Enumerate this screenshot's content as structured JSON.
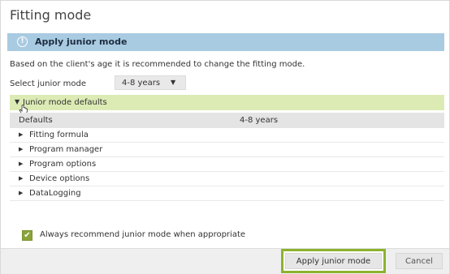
{
  "window": {
    "title": "Fitting mode"
  },
  "banner": {
    "icon": "info-icon",
    "text": "Apply junior mode"
  },
  "description": "Based on the client's age it is recommended to change the fitting mode.",
  "junior_mode": {
    "label": "Select junior mode",
    "selected": "4-8 years"
  },
  "section": {
    "title": "Junior mode defaults",
    "expanded": true
  },
  "table": {
    "columns": [
      "Defaults",
      "4-8 years"
    ],
    "rows": [
      "Fitting formula",
      "Program manager",
      "Program options",
      "Device options",
      "DataLogging"
    ]
  },
  "checkbox": {
    "label": "Always recommend junior mode when appropriate",
    "checked": true
  },
  "buttons": {
    "apply": "Apply junior mode",
    "cancel": "Cancel"
  },
  "colors": {
    "banner": "#a9cbe2",
    "section_header": "#dcebb4",
    "highlight_border": "#8db22e",
    "checkbox": "#8aa33a"
  }
}
